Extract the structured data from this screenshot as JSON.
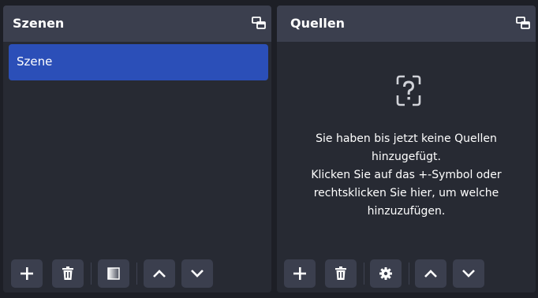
{
  "colors": {
    "background": "#1d1f26",
    "panel": "#272a33",
    "header": "#3b3f4e",
    "selected": "#2b4fb8",
    "text": "#ffffff"
  },
  "scenes": {
    "title": "Szenen",
    "float_icon": "undock-icon",
    "items": [
      {
        "label": "Szene",
        "selected": true
      }
    ],
    "toolbar": [
      {
        "icon": "plus-icon",
        "action": "add"
      },
      {
        "icon": "trash-icon",
        "action": "remove"
      },
      {
        "icon": "filter-icon",
        "action": "filters"
      },
      {
        "icon": "chevron-up-icon",
        "action": "move-up"
      },
      {
        "icon": "chevron-down-icon",
        "action": "move-down"
      }
    ]
  },
  "sources": {
    "title": "Quellen",
    "float_icon": "undock-icon",
    "empty_icon": "question-box-icon",
    "empty_text": {
      "line1": "Sie haben bis jetzt keine Quellen",
      "line2": "hinzugefügt.",
      "line3": "Klicken Sie auf das +-Symbol oder",
      "line4": "rechtsklicken Sie hier, um welche",
      "line5": "hinzuzufügen."
    },
    "toolbar": [
      {
        "icon": "plus-icon",
        "action": "add"
      },
      {
        "icon": "trash-icon",
        "action": "remove"
      },
      {
        "icon": "gear-icon",
        "action": "properties"
      },
      {
        "icon": "chevron-up-icon",
        "action": "move-up"
      },
      {
        "icon": "chevron-down-icon",
        "action": "move-down"
      }
    ]
  }
}
